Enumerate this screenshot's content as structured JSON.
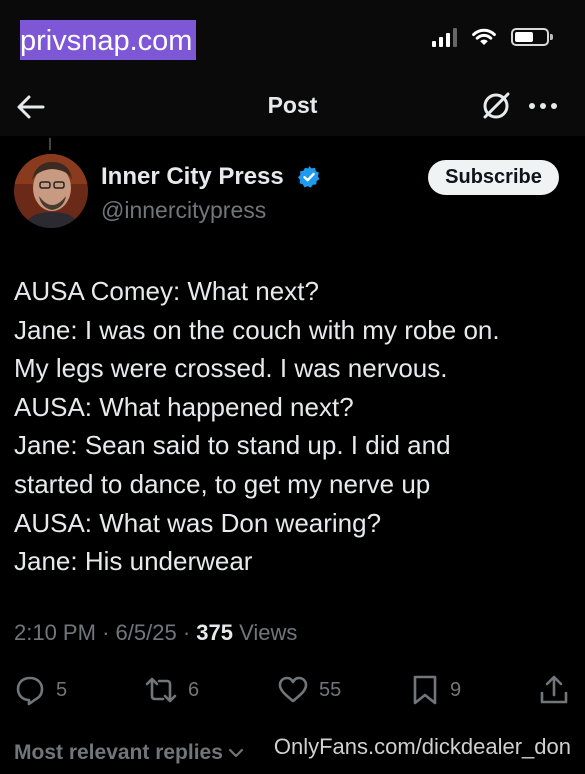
{
  "status_bar": {
    "watermark": "privsnap.com",
    "battery_level": 0.6,
    "signal_bars": 3
  },
  "nav": {
    "title": "Post",
    "back_icon": "arrow-left-icon",
    "grok_icon": "grok-icon",
    "more_icon": "more-icon"
  },
  "post": {
    "author_name": "Inner City Press",
    "handle": "@innercitypress",
    "verified": true,
    "subscribe_label": "Subscribe",
    "lines": [
      "AUSA Comey: What next?",
      "Jane: I was on the couch with my robe on.",
      "My legs were crossed. I was nervous.",
      "AUSA: What happened next?",
      "Jane: Sean said to stand up. I did and",
      "started to dance, to get my nerve up",
      "AUSA: What was Don wearing?",
      "Jane: His underwear"
    ],
    "time": "2:10 PM",
    "date": "6/5/25",
    "separator": "·",
    "views_count": "375",
    "views_label": "Views"
  },
  "actions": {
    "replies": "5",
    "reposts": "6",
    "likes": "55",
    "bookmarks": "9"
  },
  "footer": {
    "sort_label": "Most relevant replies",
    "watermark": "OnlyFans.com/dickdealer_don"
  },
  "colors": {
    "background": "#000000",
    "text": "#e7e9ea",
    "muted": "#71767b",
    "verified": "#1d9bf0",
    "watermark_bg": "#7e57d6"
  }
}
